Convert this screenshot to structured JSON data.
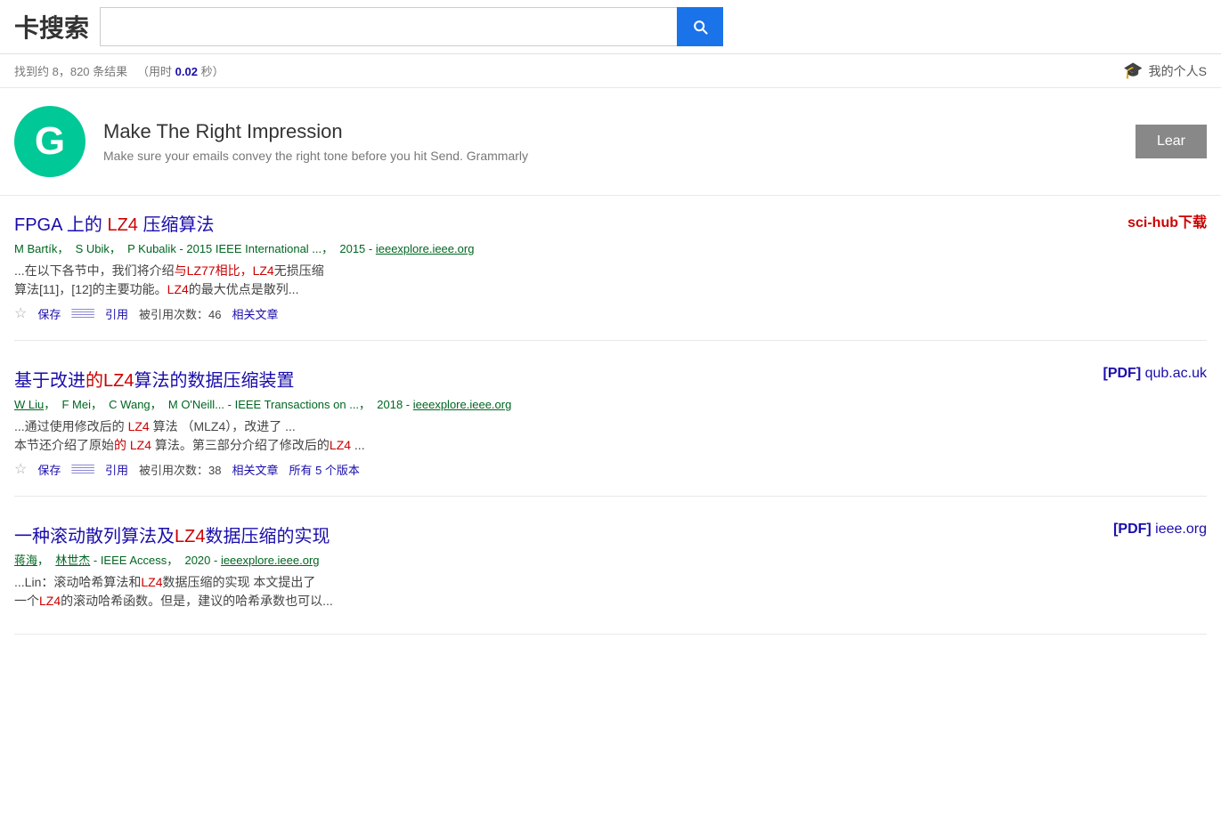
{
  "header": {
    "title": "卡搜索",
    "search_placeholder": "",
    "search_value": ""
  },
  "stats": {
    "result_count": "找到约 8，820 条结果",
    "time_text": "（用时",
    "time_value": "0.02",
    "time_unit": "秒）",
    "personal_link": "我的个人S"
  },
  "ad": {
    "logo_letter": "G",
    "title": "Make The Right Impression",
    "subtitle": "Make sure your emails convey the right tone before you hit Send. Grammarly",
    "button_label": "Lear"
  },
  "results": [
    {
      "id": 1,
      "title_parts": [
        "FPGA 上的 ",
        "LZ4",
        " 压缩算法"
      ],
      "title_highlights": [
        1
      ],
      "meta": "M Bartík，  S Ubik，  P Kubalik - 2015 IEEE International ...，  2015 - ieeexplore.ieee.org",
      "snippet_parts": [
        "...在以下各节中，我们将介绍",
        "与LZ77相比，",
        "LZ4",
        "无损压缩\n算法[11]，[12]的主要功能。",
        "LZ4",
        "的最大优点是散列..."
      ],
      "snippet_highlights": [
        1,
        2,
        4
      ],
      "cited_count": "46",
      "actions": [
        "保存",
        "引用",
        "被引用次数：",
        "相关文章"
      ],
      "side_type": "scihub",
      "side_label": "sci-hub下载",
      "has_versions": false
    },
    {
      "id": 2,
      "title_parts": [
        "基于改进",
        "的LZ4",
        "算法的数据压缩装置"
      ],
      "title_highlights": [
        1
      ],
      "meta": "W Liu，  F Mei，  C Wang，  M O'Neill... - IEEE Transactions on ...，  2018 - ieeexplore.ieee.org",
      "snippet_parts": [
        "...通过使用修改后的 ",
        "LZ4",
        " 算法 （MLZ4），改进了 ...\n本节还介绍了原始",
        "的 LZ4",
        " 算法。第三部分介绍了修改后的",
        "LZ4",
        " ..."
      ],
      "snippet_highlights": [
        1,
        3,
        5
      ],
      "cited_count": "38",
      "actions": [
        "保存",
        "引用",
        "被引用次数：",
        "相关文章",
        "所有 5 个版本"
      ],
      "side_type": "pdf",
      "side_pdf_label": "[PDF]",
      "side_pdf_source": "qub.ac.uk",
      "has_versions": true
    },
    {
      "id": 3,
      "title_parts": [
        "一种滚动散列算法及",
        "LZ4",
        "数据压缩的实现"
      ],
      "title_highlights": [
        1
      ],
      "meta": "蒋海，  林世杰 - IEEE Access，  2020 - ieeexplore.ieee.org",
      "snippet_parts": [
        "...Lin：滚动哈希算法和",
        "LZ4",
        "数据压缩的实现 本文提出了\n一个",
        "LZ4",
        "的滚动哈希函数。但是，建议的哈希承数也可以..."
      ],
      "snippet_highlights": [
        1,
        3
      ],
      "cited_count": "",
      "actions": [],
      "side_type": "pdf",
      "side_pdf_label": "[PDF]",
      "side_pdf_source": "ieee.org",
      "has_versions": false
    }
  ]
}
